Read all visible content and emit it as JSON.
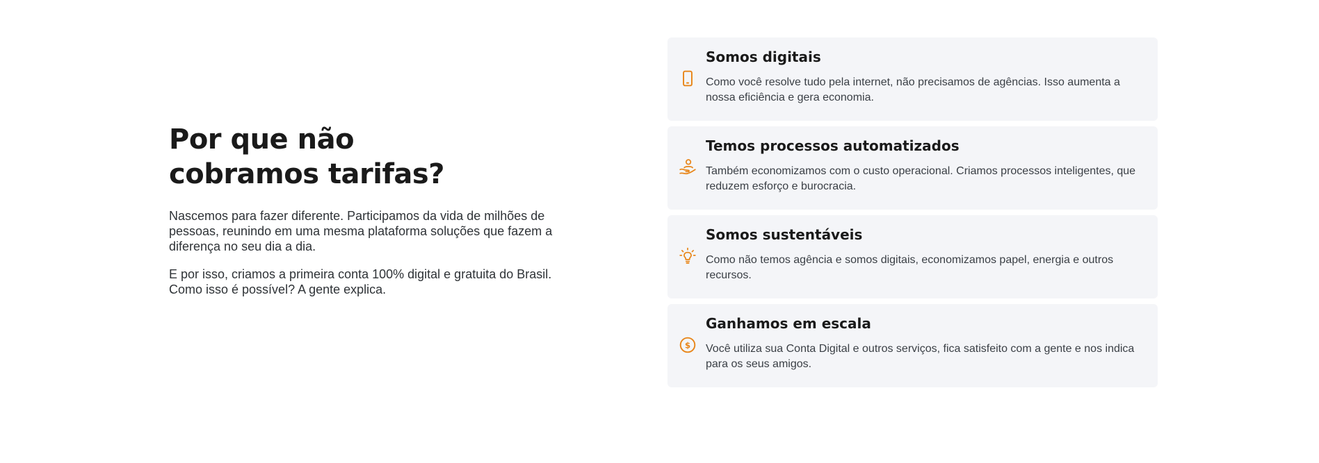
{
  "section": {
    "title_line1": "Por que não",
    "title_line2": "cobramos tarifas?",
    "paragraph1": "Nascemos para fazer diferente. Participamos da vida de milhões de pessoas, reunindo em uma mesma plataforma soluções que fazem a diferença no seu dia a dia.",
    "paragraph2": "E por isso, criamos a primeira conta 100% digital e gratuita do Brasil. Como isso é possível? A gente explica."
  },
  "accent_color": "#e8861a",
  "cards": [
    {
      "icon": "smartphone-icon",
      "title": "Somos digitais",
      "text": "Como você resolve tudo pela internet, não precisamos de agências. Isso aumenta a nossa eficiência e gera economia."
    },
    {
      "icon": "hand-user-icon",
      "title": "Temos processos automatizados",
      "text": "Também economizamos com o custo operacional. Criamos processos inteligentes, que reduzem esforço e burocracia."
    },
    {
      "icon": "lightbulb-icon",
      "title": "Somos sustentáveis",
      "text": "Como não temos agência e somos digitais, economizamos papel, energia e outros recursos."
    },
    {
      "icon": "coin-dollar-icon",
      "title": "Ganhamos em escala",
      "text": "Você utiliza sua Conta Digital e outros serviços, fica satisfeito com a gente e nos indica para os seus amigos."
    }
  ]
}
